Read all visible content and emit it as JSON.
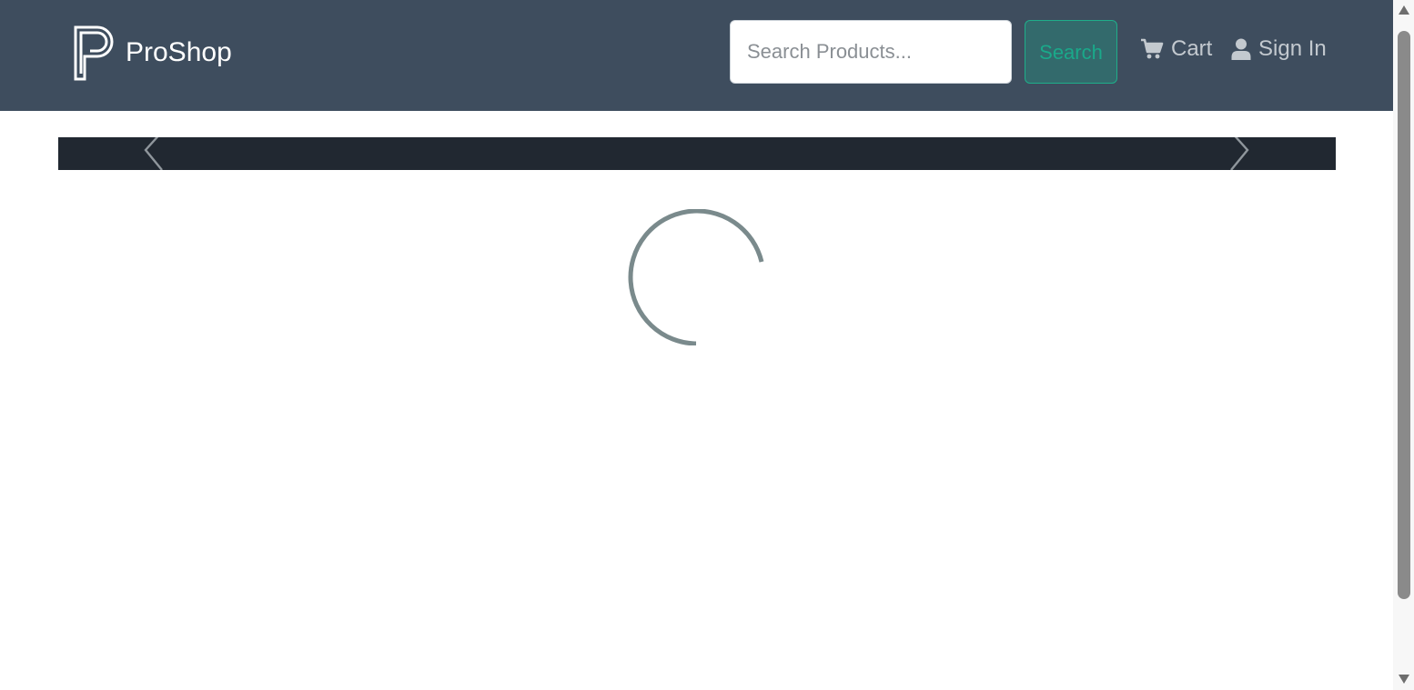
{
  "header": {
    "brand_name": "ProShop",
    "brand_icon": "proshop-logo",
    "background_color": "#3e4d5e"
  },
  "search": {
    "placeholder": "Search Products...",
    "value": "",
    "button_label": "Search",
    "button_color": "#336a6c",
    "button_text_color": "#1aa98a"
  },
  "nav": {
    "cart": {
      "label": "Cart",
      "icon": "cart-icon"
    },
    "signin": {
      "label": "Sign In",
      "icon": "user-icon"
    }
  },
  "carousel": {
    "prev_icon": "chevron-left-icon",
    "next_icon": "chevron-right-icon",
    "background_color": "#212831"
  },
  "loader": {
    "icon": "loading-spinner",
    "color": "#7a8a8c"
  }
}
